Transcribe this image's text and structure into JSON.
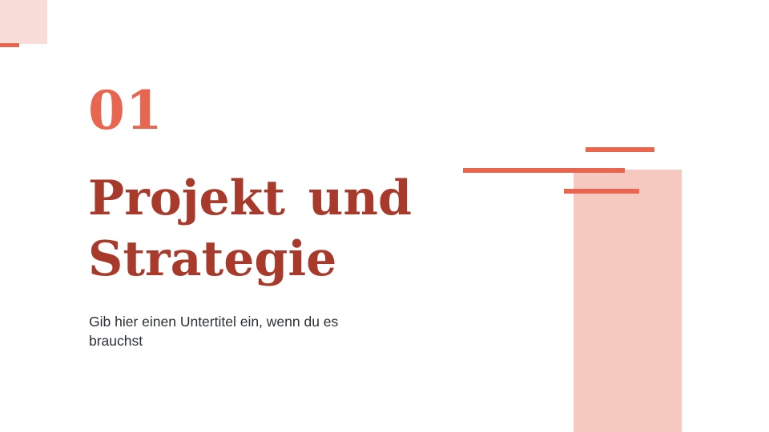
{
  "slide": {
    "section_number": "01",
    "title": "Projekt  und Strategie",
    "subtitle": "Gib hier einen Untertitel ein, wenn du es brauchst"
  },
  "colors": {
    "background": "#ffffff",
    "accent_coral": "#e8664f",
    "accent_pink": "#f5c8c0",
    "corner_pink": "#f9ddd8",
    "title_red": "#a83a2b",
    "subtitle_text": "#2b2f36"
  }
}
